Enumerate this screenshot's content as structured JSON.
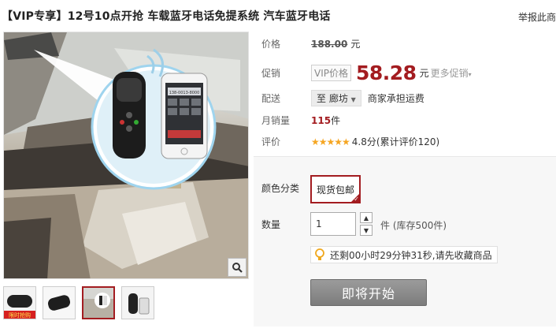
{
  "product": {
    "title": "【VIP专享】12号10点开抢 车载蓝牙电话免提系统 汽车蓝牙电话",
    "report_link": "举报此商"
  },
  "image": {
    "phone_screen_number": "138-0013-8000",
    "zoom_icon": "magnifier-icon",
    "thumb_badge": "限时抢购",
    "thumb_count": 4,
    "active_thumb": 3
  },
  "price": {
    "label": "价格",
    "original": "188.00",
    "unit": "元"
  },
  "promo": {
    "label": "促销",
    "tag": "VIP价格",
    "price": "58.28",
    "unit": "元",
    "more": "更多促销"
  },
  "shipping": {
    "label": "配送",
    "location": "至 廊坊",
    "text": "商家承担运费"
  },
  "sales": {
    "label": "月销量",
    "count": "115",
    "unit": "件"
  },
  "rating": {
    "label": "评价",
    "stars": "★★★★★",
    "score": "4.8分(累计评价120)"
  },
  "sku": {
    "label": "颜色分类",
    "option": "现货包邮"
  },
  "quantity": {
    "label": "数量",
    "value": "1",
    "stock": "件 (库存500件)"
  },
  "countdown": {
    "text": "还剩00小时29分钟31秒,请先收藏商品",
    "icon": "lightbulb-icon"
  },
  "actions": {
    "start": "即将开始"
  },
  "colors": {
    "accent": "#a31c20",
    "star": "#f5a623",
    "button_gray": "#8a8a8a"
  }
}
